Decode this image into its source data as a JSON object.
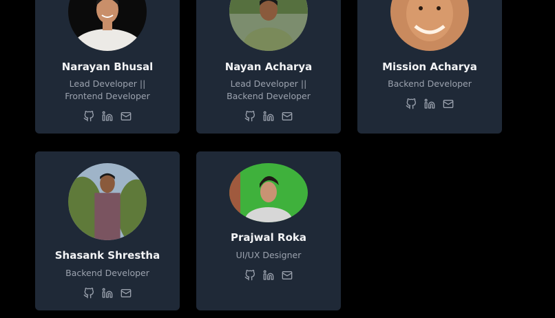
{
  "team": [
    {
      "name": "Narayan Bhusal",
      "role": "Lead Developer || Frontend Developer",
      "links": [
        "github-icon",
        "linkedin-icon",
        "mail-icon"
      ]
    },
    {
      "name": "Nayan Acharya",
      "role": "Lead Developer || Backend Developer",
      "links": [
        "github-icon",
        "linkedin-icon",
        "mail-icon"
      ]
    },
    {
      "name": "Mission Acharya",
      "role": "Backend Developer",
      "links": [
        "github-icon",
        "linkedin-icon",
        "mail-icon"
      ]
    },
    {
      "name": "Shasank Shrestha",
      "role": "Backend Developer",
      "links": [
        "github-icon",
        "linkedin-icon",
        "mail-icon"
      ]
    },
    {
      "name": "Prajwal Roka",
      "role": "UI/UX Designer",
      "links": [
        "github-icon",
        "linkedin-icon",
        "mail-icon"
      ]
    }
  ],
  "colors": {
    "page_background": "#000000",
    "card_background": "#1f2937",
    "name_text": "#f3f4f6",
    "role_text": "#9ca3af",
    "icon": "#9ca3af"
  }
}
